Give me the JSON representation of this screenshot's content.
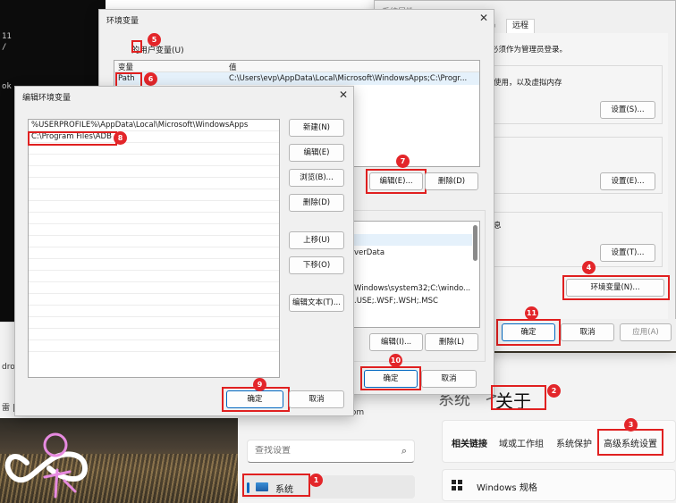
{
  "terminal": {
    "lines": [
      "11",
      "/",
      "ok"
    ]
  },
  "explorer": {
    "partial_texts": [
      "droi",
      "雷 | 汉"
    ]
  },
  "settings": {
    "breadcrumb_parent": "系统",
    "breadcrumb_sep": ">",
    "breadcrumb_current": "关于",
    "search_placeholder": "查找设置",
    "search_icon": "⌕",
    "nav_system_label": "系统",
    "partial_email": ".om",
    "related_links": [
      "相关链接",
      "域或工作组",
      "系统保护",
      "高级系统设置"
    ],
    "windows_spec": "Windows 规格"
  },
  "sysprop": {
    "title": "系统属性",
    "tab_visible": "护",
    "tab_remote": "远程",
    "text_admin": "必须作为管理员登录。",
    "text_memory": "使用，以及虚拟内存",
    "settings_btn_1": "设置(S)...",
    "settings_btn_2": "设置(E)...",
    "text_info": "息",
    "settings_btn_3": "设置(T)...",
    "env_btn": "环境变量(N)...",
    "ok": "确定",
    "cancel": "取消",
    "apply": "应用(A)"
  },
  "envvar": {
    "title": "环境变量",
    "close": "✕",
    "user_vars_label": "的用户变量(U)",
    "col_var": "变量",
    "col_val": "值",
    "path_name": "Path",
    "path_value": "C:\\Users\\evp\\AppData\\Local\\Microsoft\\WindowsApps;C:\\Progr...",
    "edit_btn": "编辑(E)...",
    "delete_btn": "删除(D)",
    "sys_rows": [
      "verData",
      "Windows\\system32;C:\\windo...",
      ".USE;.WSF;.WSH;.MSC"
    ],
    "edit_btn_2": "编辑(I)...",
    "delete_btn_2": "删除(L)",
    "ok": "确定",
    "cancel": "取消"
  },
  "editenv": {
    "title": "编辑环境变量",
    "close": "✕",
    "entries": [
      "%USERPROFILE%\\AppData\\Local\\Microsoft\\WindowsApps",
      "C:\\Program Files\\ADB"
    ],
    "buttons": [
      "新建(N)",
      "编辑(E)",
      "浏览(B)...",
      "删除(D)",
      "上移(U)",
      "下移(O)",
      "编辑文本(T)..."
    ],
    "ok": "确定",
    "cancel": "取消"
  },
  "annotations": [
    "1",
    "2",
    "3",
    "4",
    "5",
    "6",
    "7",
    "8",
    "9",
    "10",
    "11"
  ],
  "colors": {
    "annotation_red": "#e02020",
    "accent_blue": "#0067c0"
  }
}
